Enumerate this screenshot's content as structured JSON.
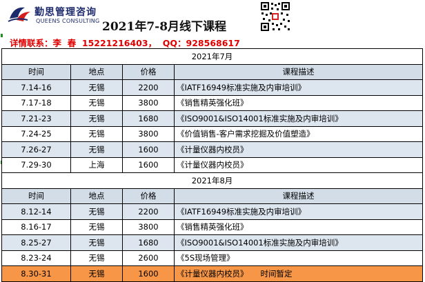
{
  "brand": {
    "name_cn": "勤思管理咨询",
    "name_en": "QUEENS CONSULTING"
  },
  "title": "2021年7-8月线下课程",
  "contact": {
    "label": "详情联系：李  春  15221216403，  QQ：928568617"
  },
  "columns": {
    "time": "时间",
    "place": "地点",
    "price": "价格",
    "desc": "课程描述"
  },
  "sections": [
    {
      "month": "2021年7月",
      "rows": [
        {
          "time": "7.14-16",
          "place": "无锡",
          "price": "2200",
          "desc": "《IATF16949标准实施及内审培训》",
          "note": ""
        },
        {
          "time": "7.17-18",
          "place": "无锡",
          "price": "3800",
          "desc": "《销售精英强化班》",
          "note": ""
        },
        {
          "time": "7.21-23",
          "place": "无锡",
          "price": "1680",
          "desc": "《ISO9001&ISO14001标准实施及内审培训》",
          "note": ""
        },
        {
          "time": "7.24-25",
          "place": "无锡",
          "price": "3800",
          "desc": "《价值销售-客户需求挖掘及价值塑造》",
          "note": ""
        },
        {
          "time": "7.26-27",
          "place": "无锡",
          "price": "1600",
          "desc": "《计量仪器内校员》",
          "note": ""
        },
        {
          "time": "7.29-30",
          "place": "上海",
          "price": "1600",
          "desc": "《计量仪器内校员》",
          "note": ""
        }
      ]
    },
    {
      "month": "2021年8月",
      "rows": [
        {
          "time": "8.12-14",
          "place": "无锡",
          "price": "2200",
          "desc": "《IATF16949标准实施及内审培训》",
          "note": ""
        },
        {
          "time": "8.16-17",
          "place": "无锡",
          "price": "3800",
          "desc": "《销售精英强化班》",
          "note": ""
        },
        {
          "time": "8.25-27",
          "place": "无锡",
          "price": "1680",
          "desc": "《ISO9001&ISO14001标准实施及内审培训》",
          "note": ""
        },
        {
          "time": "8.23-24",
          "place": "无锡",
          "price": "2600",
          "desc": "《5S现场管理》",
          "note": ""
        },
        {
          "time": "8.30-31",
          "place": "无锡",
          "price": "1600",
          "desc": "《计量仪器内校员》",
          "note": "时间暂定"
        }
      ]
    }
  ],
  "colors": {
    "title_red": "#e00000",
    "header_fill": "#d3dde8",
    "row_fill": "#dde5ef",
    "highlight_fill": "#f79646",
    "brand_blue": "#1d2a6b"
  }
}
